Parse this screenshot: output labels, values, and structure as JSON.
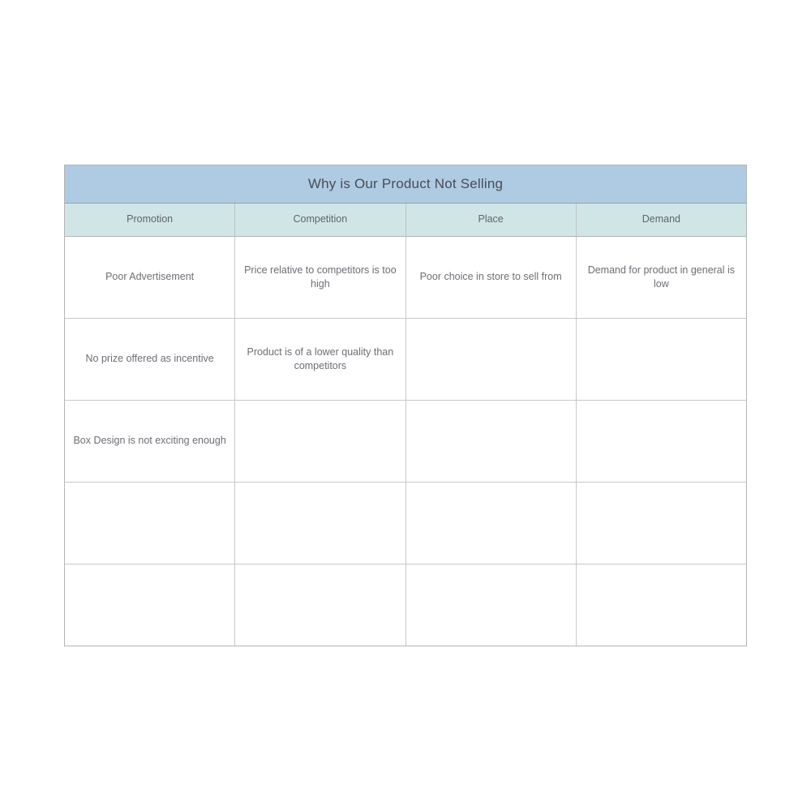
{
  "matrix": {
    "title": "Why is Our Product Not Selling",
    "colors": {
      "title_background": "#AFCBE3",
      "header_background": "#D0E6E6",
      "cell_background": "#FFFFFF",
      "border": "#C8C8C8",
      "outer_border": "#B4B4B4",
      "title_text": "#4B4B53",
      "header_text": "#63636B",
      "cell_text": "#6E6E76"
    },
    "columns": [
      {
        "label": "Promotion"
      },
      {
        "label": "Competition"
      },
      {
        "label": "Place"
      },
      {
        "label": "Demand"
      }
    ],
    "rows": [
      {
        "cells": [
          "Poor Advertisement",
          "Price relative to competitors is too high",
          "Poor choice in store to sell from",
          "Demand for product in general is low"
        ]
      },
      {
        "cells": [
          "No prize offered as incentive",
          "Product is of a lower quality than competitors",
          "",
          ""
        ]
      },
      {
        "cells": [
          "Box Design is not exciting enough",
          "",
          "",
          ""
        ]
      },
      {
        "cells": [
          "",
          "",
          "",
          ""
        ]
      },
      {
        "cells": [
          "",
          "",
          "",
          ""
        ]
      }
    ]
  }
}
